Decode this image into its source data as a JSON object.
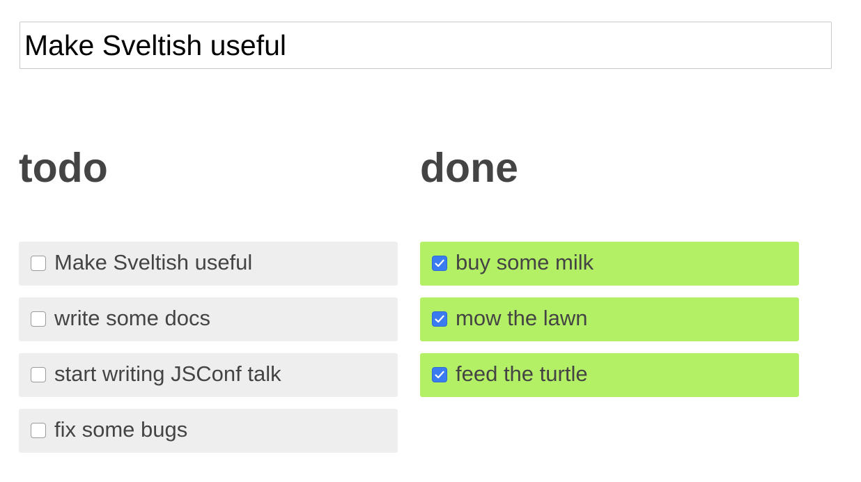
{
  "new_todo": {
    "value": "Make Sveltish useful"
  },
  "todo": {
    "heading": "todo",
    "items": [
      {
        "label": "Make Sveltish useful",
        "done": false
      },
      {
        "label": "write some docs",
        "done": false
      },
      {
        "label": "start writing JSConf talk",
        "done": false
      },
      {
        "label": "fix some bugs",
        "done": false
      }
    ]
  },
  "done": {
    "heading": "done",
    "items": [
      {
        "label": "buy some milk",
        "done": true
      },
      {
        "label": "mow the lawn",
        "done": true
      },
      {
        "label": "feed the turtle",
        "done": true
      }
    ]
  },
  "colors": {
    "todo_item_bg": "#eeeeee",
    "done_item_bg": "#b4f066",
    "checkbox_checked": "#3a7cf0",
    "text": "#444444"
  },
  "icons": {
    "checked": "checkmark-icon"
  }
}
